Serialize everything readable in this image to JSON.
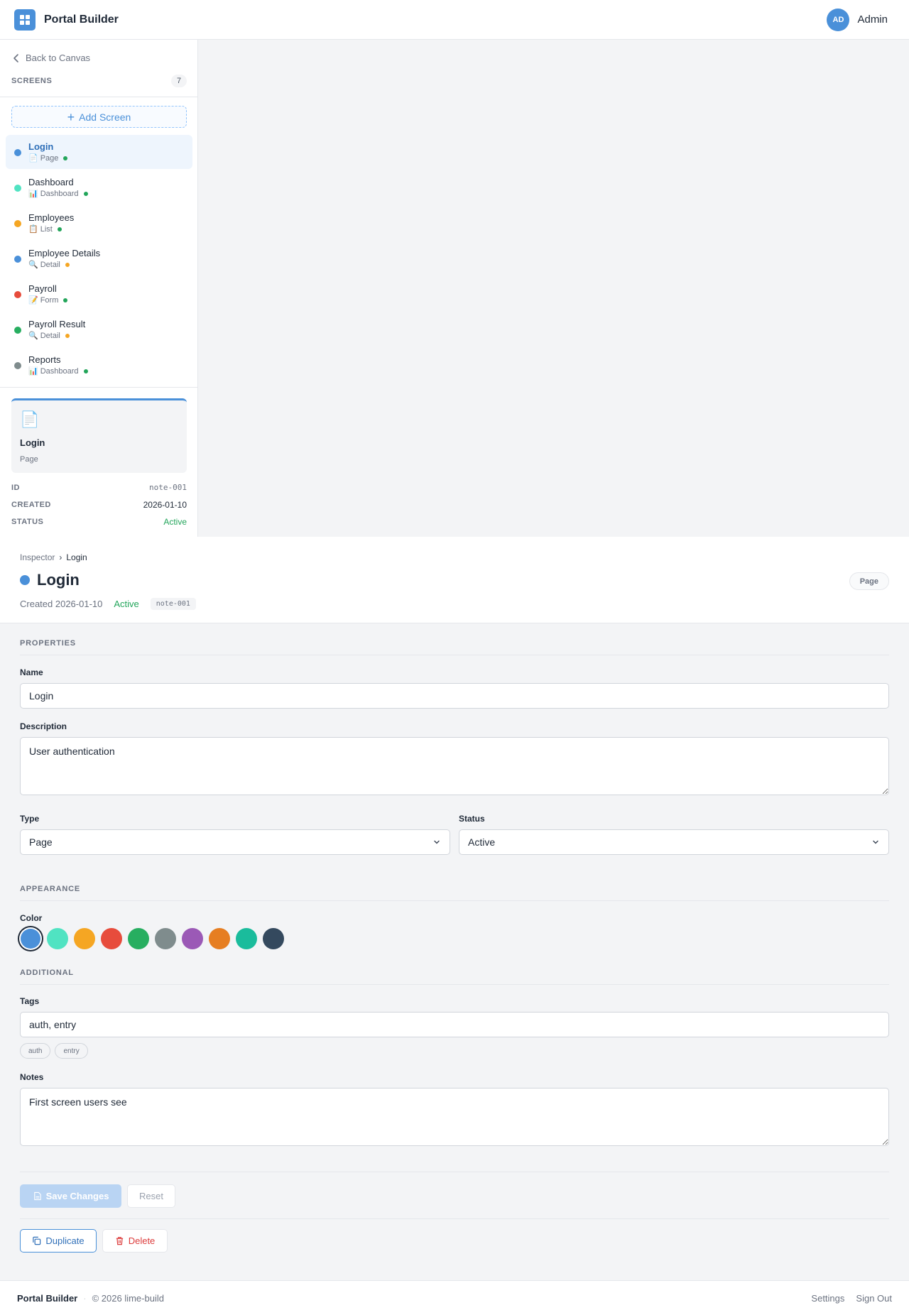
{
  "app": {
    "title": "Portal Builder"
  },
  "user": {
    "initials": "AD",
    "name": "Admin"
  },
  "sidebar": {
    "back_label": "Back to Canvas",
    "screens_title": "SCREENS",
    "screens_count": "7",
    "add_screen_label": "Add Screen",
    "items": [
      {
        "name": "Login",
        "icon": "📄",
        "type": "Page",
        "color": "#4a90d9",
        "status_color": "#22a55a"
      },
      {
        "name": "Dashboard",
        "icon": "📊",
        "type": "Dashboard",
        "color": "#50e3c2",
        "status_color": "#22a55a"
      },
      {
        "name": "Employees",
        "icon": "📋",
        "type": "List",
        "color": "#f5a623",
        "status_color": "#22a55a"
      },
      {
        "name": "Employee Details",
        "icon": "🔍",
        "type": "Detail",
        "color": "#4a90d9",
        "status_color": "#f5a623"
      },
      {
        "name": "Payroll",
        "icon": "📝",
        "type": "Form",
        "color": "#e74c3c",
        "status_color": "#22a55a"
      },
      {
        "name": "Payroll Result",
        "icon": "🔍",
        "type": "Detail",
        "color": "#27ae60",
        "status_color": "#f5a623"
      },
      {
        "name": "Reports",
        "icon": "📊",
        "type": "Dashboard",
        "color": "#7f8c8d",
        "status_color": "#22a55a"
      }
    ],
    "preview": {
      "icon": "📄",
      "name": "Login",
      "type": "Page"
    },
    "meta": {
      "id_label": "ID",
      "id_value": "note-001",
      "created_label": "CREATED",
      "created_value": "2026-01-10",
      "status_label": "STATUS",
      "status_value": "Active"
    }
  },
  "inspector": {
    "breadcrumb_root": "Inspector",
    "breadcrumb_current": "Login",
    "title": "Login",
    "type_pill": "Page",
    "created_text": "Created 2026-01-10",
    "status_text": "Active",
    "id_chip": "note-001"
  },
  "form": {
    "properties_title": "PROPERTIES",
    "name_label": "Name",
    "name_value": "Login",
    "description_label": "Description",
    "description_value": "User authentication",
    "type_label": "Type",
    "type_value": "Page",
    "status_label": "Status",
    "status_value": "Active",
    "appearance_title": "APPEARANCE",
    "color_label": "Color",
    "colors": [
      "#4a90d9",
      "#50e3c2",
      "#f5a623",
      "#e74c3c",
      "#27ae60",
      "#7f8c8d",
      "#9b59b6",
      "#e67e22",
      "#1abc9c",
      "#34495e"
    ],
    "selected_color_index": 0,
    "additional_title": "ADDITIONAL",
    "tags_label": "Tags",
    "tags_value": "auth, entry",
    "tag_chips": [
      "auth",
      "entry"
    ],
    "notes_label": "Notes",
    "notes_value": "First screen users see"
  },
  "actions": {
    "save_label": "Save Changes",
    "reset_label": "Reset",
    "duplicate_label": "Duplicate",
    "delete_label": "Delete"
  },
  "footer": {
    "brand": "Portal Builder",
    "separator": "·",
    "copyright": "© 2026 lime-build",
    "settings_label": "Settings",
    "signout_label": "Sign Out"
  }
}
